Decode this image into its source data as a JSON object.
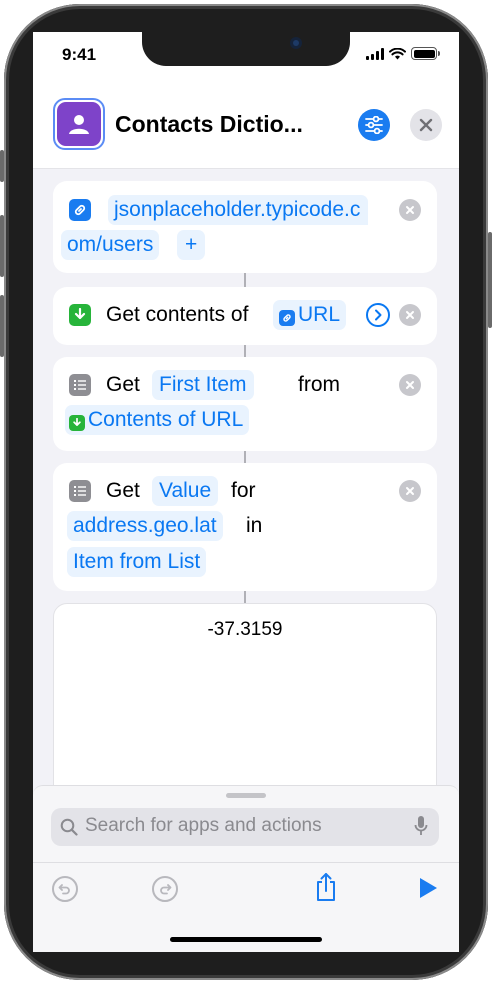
{
  "status_bar": {
    "time": "9:41"
  },
  "header": {
    "title": "Contacts Dictio...",
    "app_icon": "person-icon",
    "settings_icon": "sliders-icon",
    "close_icon": "close-icon",
    "accent": "#1a7cf0",
    "app_icon_color": "#7e43c9"
  },
  "actions": [
    {
      "type": "url",
      "icon": "link-icon",
      "url_line1": "jsonplaceholder.typicode.c",
      "url_line2": "om/users",
      "add_label": "+"
    },
    {
      "type": "get-contents",
      "icon": "download-icon",
      "label": "Get contents of",
      "param": "URL"
    },
    {
      "type": "get-item",
      "icon": "list-icon",
      "word1": "Get",
      "param1": "First Item",
      "word2": "from",
      "param2": "Contents of URL"
    },
    {
      "type": "get-value",
      "icon": "list-icon",
      "word1": "Get",
      "param1": "Value",
      "word2": "for",
      "param2": "address.geo.lat",
      "word3": "in",
      "param3": "Item from List"
    }
  ],
  "result": {
    "value": "-37.3159"
  },
  "search": {
    "placeholder": "Search for apps and actions"
  },
  "toolbar": {
    "undo_icon": "undo-icon",
    "redo_icon": "redo-icon",
    "share_icon": "share-icon",
    "play_icon": "play-icon"
  }
}
